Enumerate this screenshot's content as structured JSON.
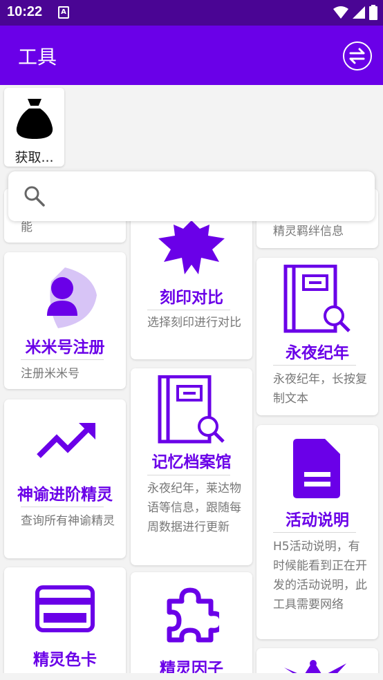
{
  "status_bar": {
    "time": "10:22",
    "notification_glyph": "A"
  },
  "app_bar": {
    "title": "工具",
    "action_icon": "swap-icon"
  },
  "top_item": {
    "label": "获取..."
  },
  "search": {
    "placeholder": ""
  },
  "cards": {
    "c1_partial_desc": "能",
    "c2": {
      "title": "刻印对比",
      "desc": "选择刻印进行对比"
    },
    "c3_partial_desc": "精灵羁绊信息",
    "c4": {
      "title": "米米号注册",
      "desc": "注册米米号"
    },
    "c5": {
      "title": "永夜纪年",
      "desc": "永夜纪年，长按复制文本"
    },
    "c6": {
      "title": "记忆档案馆",
      "desc": "永夜纪年，莱达物语等信息，跟随每周数据进行更新"
    },
    "c7": {
      "title": "神谕进阶精灵",
      "desc": "查询所有神谕精灵"
    },
    "c8": {
      "title": "活动说明",
      "desc": "H5活动说明，有时候能看到正在开发的活动说明，此工具需要网络"
    },
    "c9": {
      "title": "精灵色卡"
    },
    "c10": {
      "title": "精灵因子"
    }
  },
  "colors": {
    "accent": "#6a00e8",
    "status_bar": "#4a0594"
  }
}
